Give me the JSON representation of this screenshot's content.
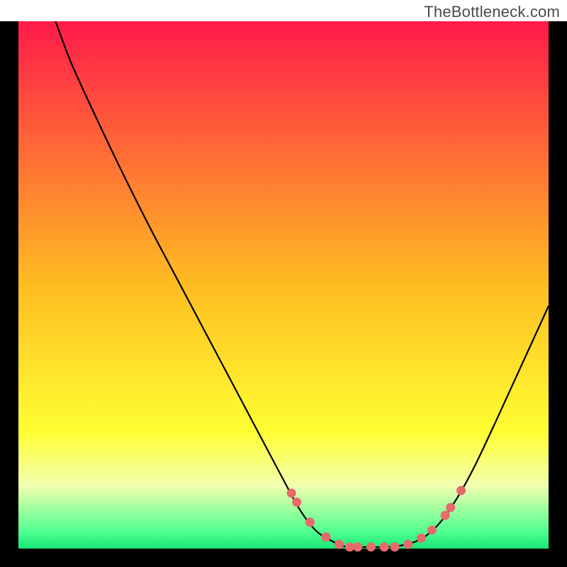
{
  "watermark": "TheBottleneck.com",
  "chart_data": {
    "type": "line",
    "title": "",
    "xlabel": "",
    "ylabel": "",
    "xlim": [
      0,
      100
    ],
    "ylim": [
      0,
      100
    ],
    "background_gradient": [
      {
        "pos": 0,
        "color": "#ff1a4a"
      },
      {
        "pos": 50,
        "color": "#ffbd22"
      },
      {
        "pos": 78,
        "color": "#ffff33"
      },
      {
        "pos": 88,
        "color": "#f3ffb0"
      },
      {
        "pos": 97,
        "color": "#4cff8f"
      },
      {
        "pos": 100,
        "color": "#18e676"
      }
    ],
    "series": [
      {
        "name": "bottleneck-curve",
        "color": "#000000",
        "points": [
          {
            "x": 7.0,
            "y": 100.0
          },
          {
            "x": 10.0,
            "y": 92.0
          },
          {
            "x": 15.0,
            "y": 81.0
          },
          {
            "x": 20.0,
            "y": 70.5
          },
          {
            "x": 25.0,
            "y": 60.5
          },
          {
            "x": 30.0,
            "y": 51.0
          },
          {
            "x": 35.0,
            "y": 41.5
          },
          {
            "x": 40.0,
            "y": 32.0
          },
          {
            "x": 45.0,
            "y": 22.5
          },
          {
            "x": 50.0,
            "y": 13.0
          },
          {
            "x": 53.0,
            "y": 7.5
          },
          {
            "x": 56.0,
            "y": 3.5
          },
          {
            "x": 59.0,
            "y": 1.5
          },
          {
            "x": 62.0,
            "y": 0.3
          },
          {
            "x": 66.0,
            "y": 0.3
          },
          {
            "x": 70.0,
            "y": 0.3
          },
          {
            "x": 74.0,
            "y": 1.0
          },
          {
            "x": 77.0,
            "y": 2.5
          },
          {
            "x": 80.0,
            "y": 5.5
          },
          {
            "x": 83.0,
            "y": 10.0
          },
          {
            "x": 86.0,
            "y": 15.5
          },
          {
            "x": 90.0,
            "y": 24.0
          },
          {
            "x": 95.0,
            "y": 35.0
          },
          {
            "x": 100.0,
            "y": 46.0
          }
        ]
      },
      {
        "name": "data-points",
        "color": "#e86a6a",
        "marker": "circle",
        "points": [
          {
            "x": 51.5,
            "y": 10.5
          },
          {
            "x": 52.5,
            "y": 8.8
          },
          {
            "x": 55.0,
            "y": 5.0
          },
          {
            "x": 58.0,
            "y": 2.2
          },
          {
            "x": 60.5,
            "y": 0.8
          },
          {
            "x": 62.5,
            "y": 0.3
          },
          {
            "x": 64.0,
            "y": 0.3
          },
          {
            "x": 66.5,
            "y": 0.3
          },
          {
            "x": 69.0,
            "y": 0.3
          },
          {
            "x": 71.0,
            "y": 0.3
          },
          {
            "x": 73.5,
            "y": 0.8
          },
          {
            "x": 76.0,
            "y": 2.0
          },
          {
            "x": 78.0,
            "y": 3.5
          },
          {
            "x": 80.5,
            "y": 6.3
          },
          {
            "x": 81.5,
            "y": 7.8
          },
          {
            "x": 83.5,
            "y": 11.0
          }
        ]
      }
    ]
  }
}
